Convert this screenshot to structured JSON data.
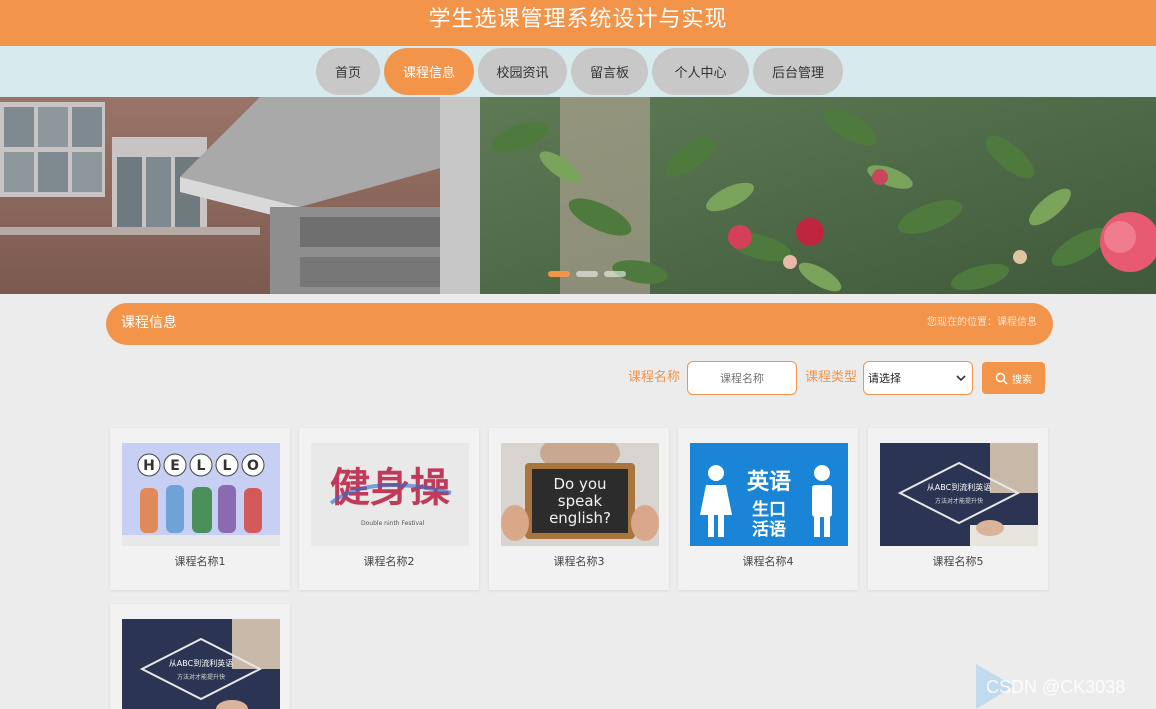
{
  "header": {
    "title": "学生选课管理系统设计与实现"
  },
  "nav": {
    "items": [
      {
        "label": "首页",
        "active": false
      },
      {
        "label": "课程信息",
        "active": true
      },
      {
        "label": "校园资讯",
        "active": false
      },
      {
        "label": "留言板",
        "active": false
      },
      {
        "label": "个人中心",
        "active": false
      },
      {
        "label": "后台管理",
        "active": false
      }
    ]
  },
  "banner": {
    "slide_count": 3,
    "active_slide": 1
  },
  "section": {
    "title": "课程信息",
    "breadcrumb": "您现在的位置：课程信息"
  },
  "search": {
    "name_label": "课程名称",
    "name_placeholder": "课程名称",
    "type_label": "课程类型",
    "type_selected": "请选择",
    "button_label": "搜索"
  },
  "courses": [
    {
      "name": "课程名称1",
      "thumb_text": "HELLO"
    },
    {
      "name": "课程名称2",
      "thumb_text": "健身操",
      "thumb_subtext": "Double ninth Festival"
    },
    {
      "name": "课程名称3",
      "thumb_text": "Do you speak english?"
    },
    {
      "name": "课程名称4",
      "thumb_text": "英语",
      "thumb_subtext": "生活口语"
    },
    {
      "name": "课程名称5",
      "thumb_text": "从ABC到流利英语",
      "thumb_subtext": "方法对才能提升快"
    },
    {
      "name": "",
      "thumb_text": "从ABC到流利英语",
      "thumb_subtext": "方法对才能提升快"
    }
  ],
  "watermark": "CSDN @CK3038",
  "colors": {
    "accent": "#f2944a",
    "nav_bg": "#d7eaee",
    "page_bg": "#ececec"
  }
}
